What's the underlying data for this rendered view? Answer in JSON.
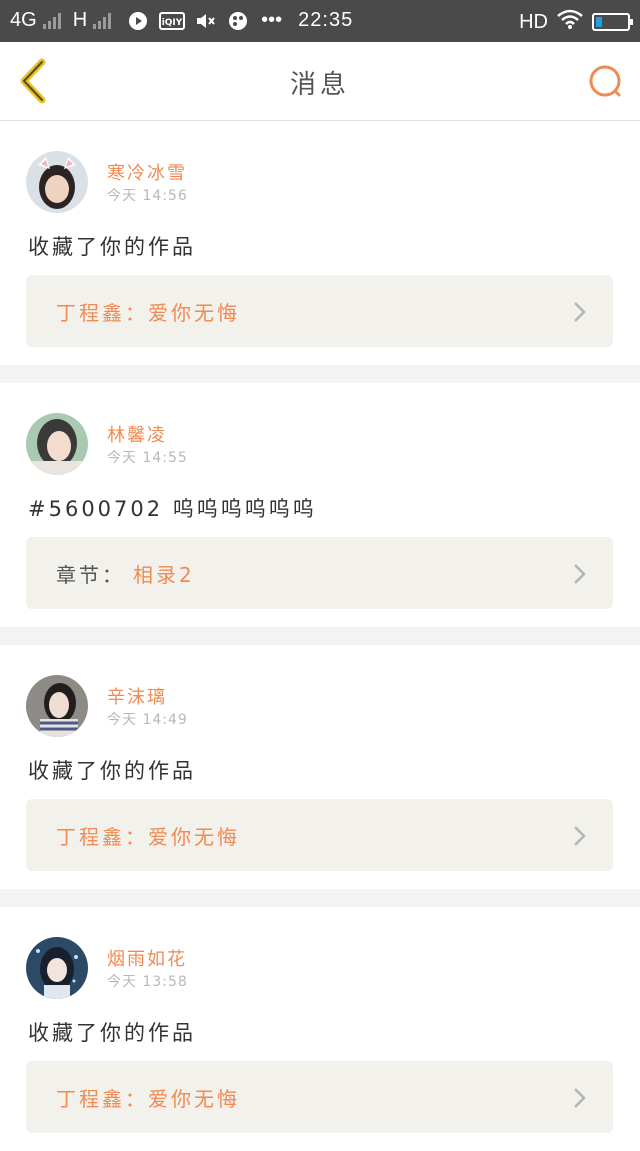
{
  "status_bar": {
    "network": "4G",
    "network2": "H",
    "time": "22:35",
    "hd_label": "HD",
    "battery_fraction": 0.2,
    "app_icons": [
      "play-icon",
      "iqiyi-icon",
      "muted-speaker-icon",
      "palette-icon",
      "more-dots-icon"
    ],
    "iqiyi_text": "iQIY",
    "dots": "•••"
  },
  "header": {
    "title": "消息"
  },
  "messages": [
    {
      "name": "寒冷冰雪",
      "time": "今天 14:56",
      "text": "收藏了你的作品",
      "ref_label": "",
      "ref_value": "丁程鑫：爱你无悔"
    },
    {
      "name": "林馨凌",
      "time": "今天 14:55",
      "text": "#5600702 呜呜呜呜呜呜",
      "ref_label": "章节：",
      "ref_value": "相录2"
    },
    {
      "name": "辛沫璃",
      "time": "今天 14:49",
      "text": "收藏了你的作品",
      "ref_label": "",
      "ref_value": "丁程鑫：爱你无悔"
    },
    {
      "name": "烟雨如花",
      "time": "今天 13:58",
      "text": "收藏了你的作品",
      "ref_label": "",
      "ref_value": "丁程鑫：爱你无悔"
    }
  ],
  "colors": {
    "accent": "#ef8b53",
    "back_arrow": "#e8c22a",
    "ref_bg": "#f2f1eb"
  }
}
